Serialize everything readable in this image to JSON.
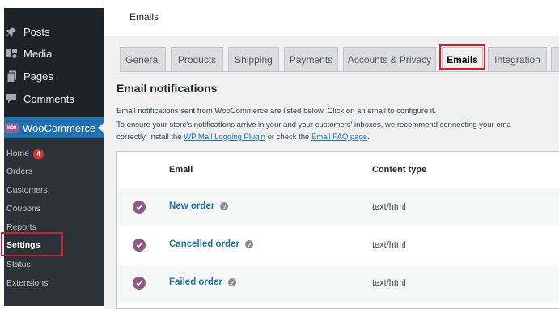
{
  "sidebar": {
    "menu": [
      {
        "label": "Posts",
        "icon": "pushpin-icon"
      },
      {
        "label": "Media",
        "icon": "media-icon"
      },
      {
        "label": "Pages",
        "icon": "pages-icon"
      },
      {
        "label": "Comments",
        "icon": "comments-icon"
      }
    ],
    "woocommerce": {
      "label": "WooCommerce",
      "logo_text": "woo"
    },
    "submenu": {
      "home": {
        "label": "Home",
        "badge": "4"
      },
      "orders": "Orders",
      "customers": "Customers",
      "coupons": "Coupons",
      "reports": "Reports",
      "settings": "Settings",
      "status": "Status",
      "extensions": "Extensions"
    }
  },
  "topbar": {
    "title": "Emails"
  },
  "tabs": [
    "General",
    "Products",
    "Shipping",
    "Payments",
    "Accounts & Privacy",
    "Emails",
    "Integration"
  ],
  "active_tab": "Emails",
  "section": {
    "title": "Email notifications",
    "line1": "Email notifications sent from WooCommerce are listed below. Click on an email to configure it.",
    "line2": "To ensure your store's notifications arrive in your and your customers' inboxes, we recommend connecting your ema",
    "line3_prefix": "correctly, install the ",
    "plugin_link": "WP Mail Logging Plugin",
    "line3_middle": " or check the ",
    "faq_link": "Email FAQ page",
    "line3_suffix": "."
  },
  "table": {
    "headers": {
      "email": "Email",
      "content_type": "Content type"
    },
    "rows": [
      {
        "name": "New order",
        "content_type": "text/html"
      },
      {
        "name": "Cancelled order",
        "content_type": "text/html"
      },
      {
        "name": "Failed order",
        "content_type": "text/html"
      }
    ]
  },
  "colors": {
    "sidebar_bg": "#1d2327",
    "submenu_bg": "#2c3338",
    "woo_active": "#2271b1",
    "woo_purple": "#8e5a8a",
    "link": "#2271b1",
    "highlight_red": "#d01e2c"
  }
}
